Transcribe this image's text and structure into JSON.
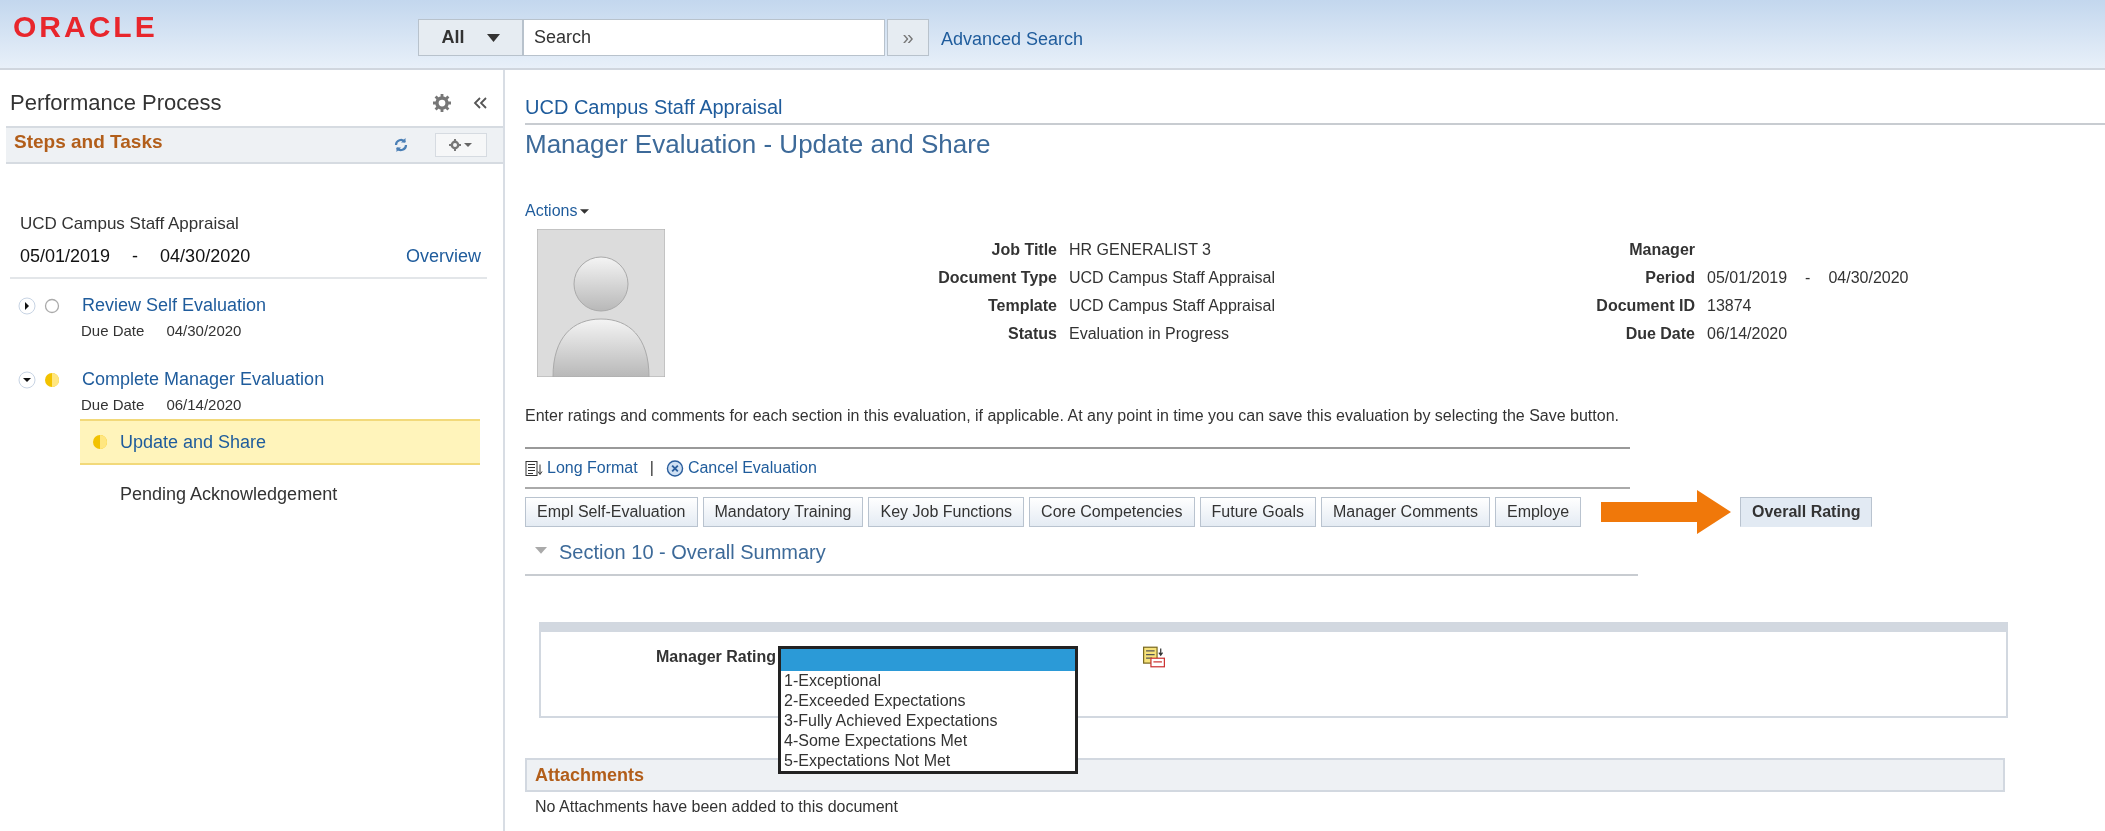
{
  "header": {
    "logo": "ORACLE",
    "search_scope": "All",
    "search": {
      "placeholder": "Search"
    },
    "search_button": "»",
    "advanced_search": "Advanced Search"
  },
  "sidebar": {
    "title": "Performance Process",
    "section_title": "Steps and Tasks",
    "document": "UCD Campus Staff Appraisal",
    "period_start": "05/01/2019",
    "period_sep": "-",
    "period_end": "04/30/2020",
    "overview_link": "Overview",
    "steps": [
      {
        "title": "Review Self Evaluation",
        "kind": "not-started",
        "expanded": false,
        "due_label": "Due Date",
        "due": "04/30/2020"
      },
      {
        "title": "Complete Manager Evaluation",
        "kind": "in-progress",
        "expanded": true,
        "due_label": "Due Date",
        "due": "06/14/2020",
        "children": [
          {
            "title": "Update and Share",
            "kind": "in-progress",
            "selected": true
          },
          {
            "title": "Pending Acknowledgement",
            "selected": false
          }
        ]
      }
    ]
  },
  "main": {
    "breadcrumb": "UCD Campus Staff Appraisal",
    "title": "Manager Evaluation - Update and Share",
    "actions": "Actions",
    "details_left": [
      {
        "label": "Job Title",
        "value": "HR GENERALIST 3"
      },
      {
        "label": "Document Type",
        "value": "UCD Campus Staff Appraisal"
      },
      {
        "label": "Template",
        "value": "UCD Campus Staff Appraisal"
      },
      {
        "label": "Status",
        "value": "Evaluation in Progress"
      }
    ],
    "details_right": [
      {
        "label": "Manager"
      },
      {
        "label": "Period",
        "value": "05/01/2019",
        "value_sep": "-",
        "value_end": "04/30/2020"
      },
      {
        "label": "Document ID",
        "value": "13874"
      },
      {
        "label": "Due Date",
        "value": "06/14/2020"
      }
    ],
    "instructions": "Enter ratings and comments for each section in this evaluation, if applicable. At any point in time you can save this evaluation by selecting the Save button.",
    "toolbar": {
      "long_format": "Long Format",
      "separator": "|",
      "cancel": "Cancel Evaluation"
    },
    "tabs": [
      {
        "label": "Empl Self-Evaluation",
        "selected": false
      },
      {
        "label": "Mandatory Training",
        "selected": false
      },
      {
        "label": "Key Job Functions",
        "selected": false
      },
      {
        "label": "Core Competencies",
        "selected": false
      },
      {
        "label": "Future Goals",
        "selected": false
      },
      {
        "label": "Manager Comments",
        "selected": false
      },
      {
        "label": "Employe",
        "selected": false,
        "arrow_over": true
      },
      {
        "label": "Overall Rating",
        "selected": true
      }
    ],
    "section_title": "Section 10 - Overall Summary",
    "section_expanded": true,
    "rating": {
      "label": "Manager Rating",
      "dropdown_open": true,
      "blank_option_highlighted": true,
      "options": [
        {
          "label": "1-Exceptional"
        },
        {
          "label": "2-Exceeded Expectations"
        },
        {
          "label": "3-Fully Achieved Expectations"
        },
        {
          "label": "4-Some Expectations Met"
        },
        {
          "label": "5-Expectations Not Met"
        }
      ]
    },
    "attachments": {
      "title": "Attachments",
      "message": "No Attachments have been added to this document"
    }
  }
}
